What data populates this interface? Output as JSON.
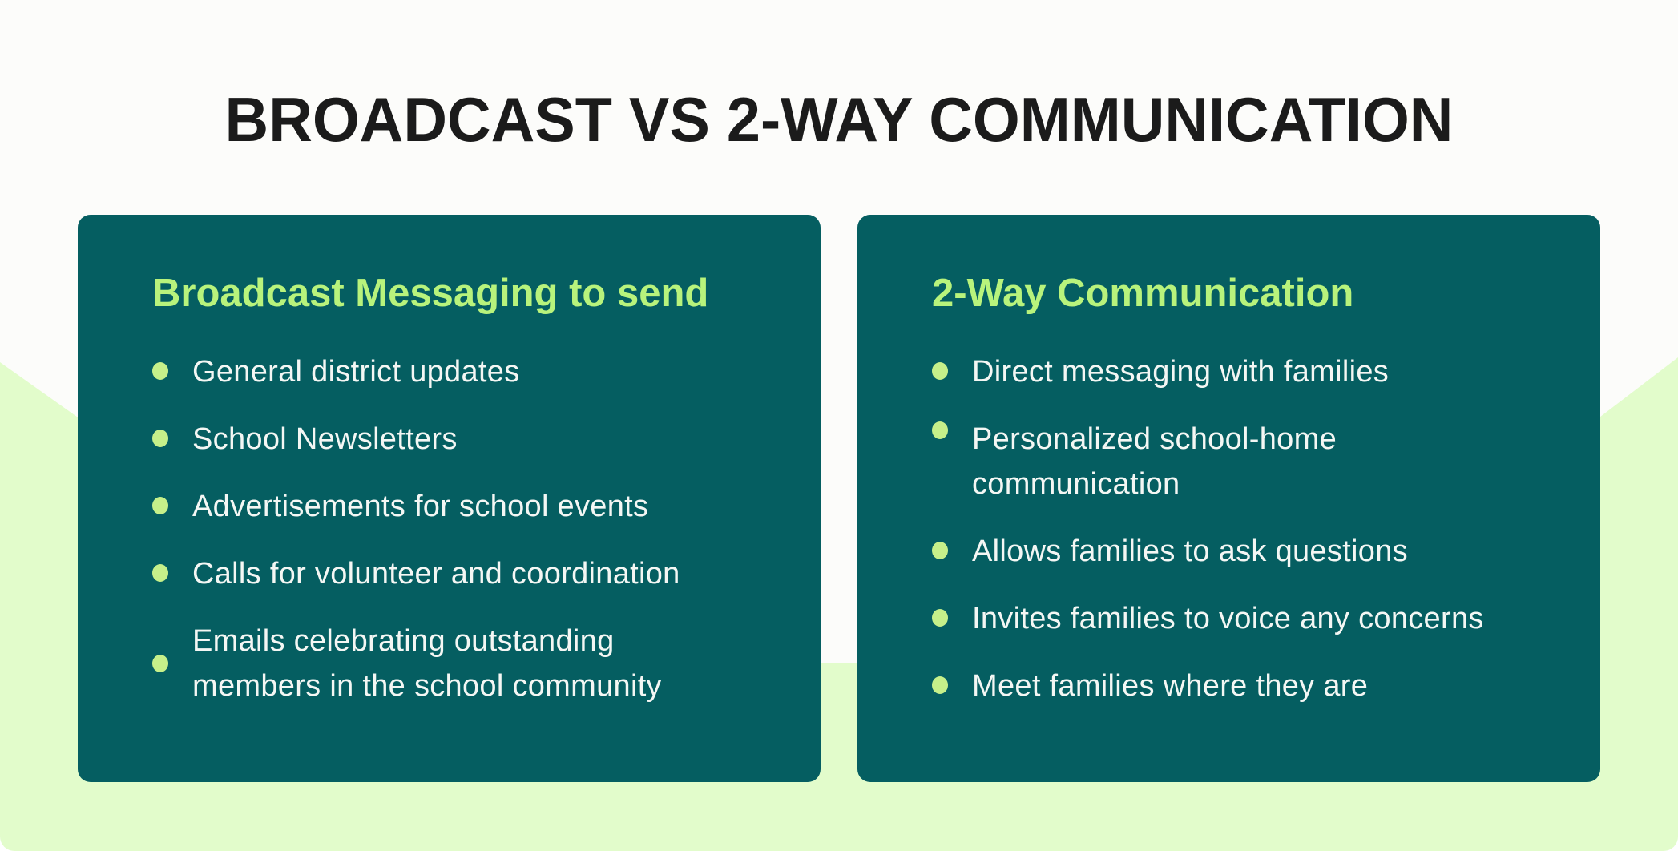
{
  "title": "BROADCAST VS 2-WAY COMMUNICATION",
  "colors": {
    "background": "#fcfcfa",
    "accent_background": "#e2fccb",
    "card": "#055e61",
    "card_title": "#b8f37c",
    "bullet": "#c6f08a",
    "title_text": "#1b1b1b",
    "item_text": "#f4f7f4"
  },
  "cards": [
    {
      "title": "Broadcast Messaging to send",
      "items": [
        "General district updates",
        "School Newsletters",
        "Advertisements for school events",
        "Calls for volunteer and coordination",
        "Emails celebrating outstanding\nmembers in the school community"
      ]
    },
    {
      "title": "2-Way Communication",
      "items": [
        "Direct messaging with families",
        "Personalized school-home\ncommunication",
        "Allows families to ask questions",
        "Invites families to voice any concerns",
        "Meet families where they are"
      ]
    }
  ]
}
